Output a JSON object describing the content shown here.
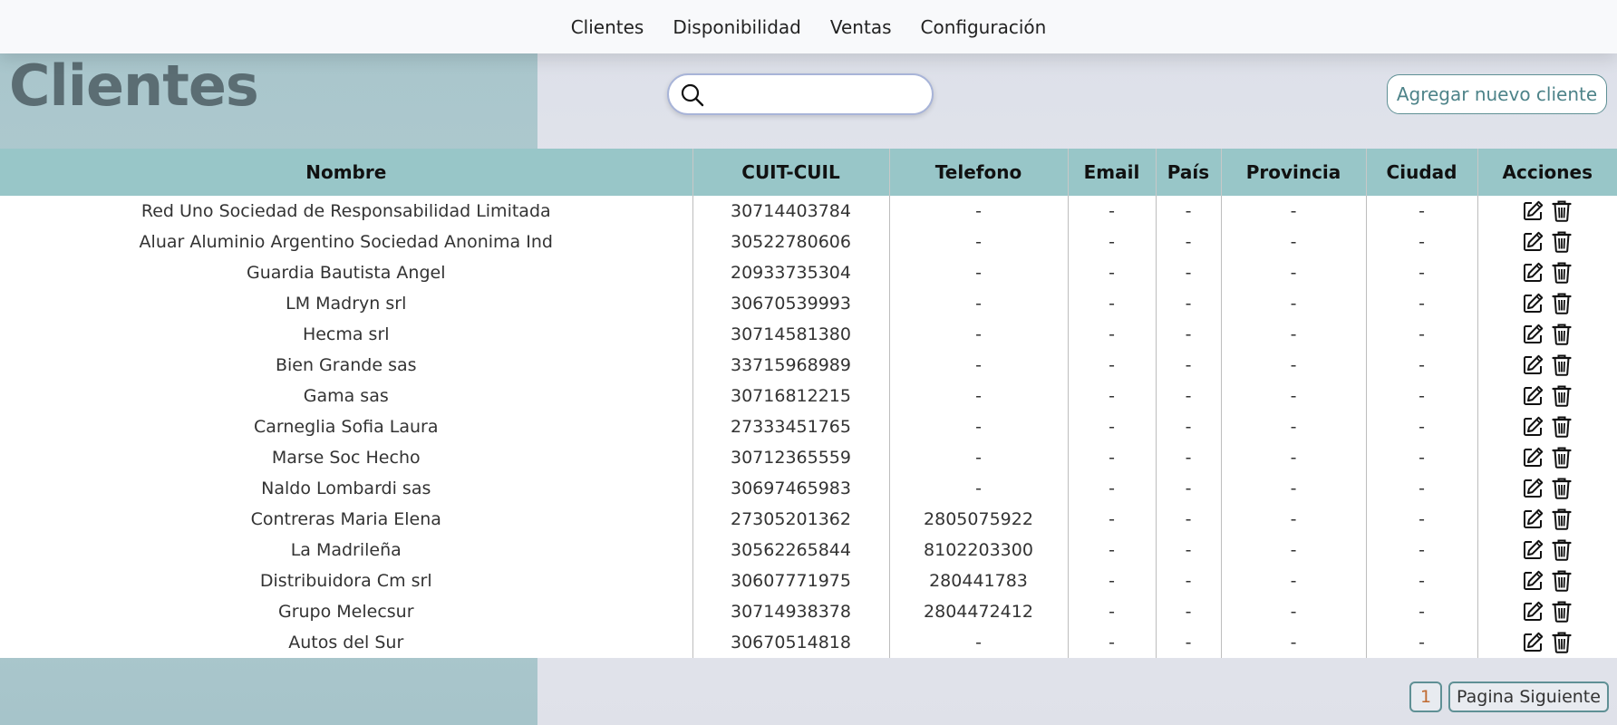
{
  "nav": {
    "items": [
      {
        "label": "Clientes"
      },
      {
        "label": "Disponibilidad"
      },
      {
        "label": "Ventas"
      },
      {
        "label": "Configuración"
      }
    ]
  },
  "header": {
    "title": "Clientes",
    "search": {
      "value": "",
      "placeholder": "",
      "icon": "search-icon"
    },
    "add_button_label": "Agregar nuevo cliente"
  },
  "table": {
    "columns": [
      "Nombre",
      "CUIT-CUIL",
      "Telefono",
      "Email",
      "País",
      "Provincia",
      "Ciudad",
      "Acciones"
    ],
    "rows": [
      {
        "nombre": "Red Uno Sociedad de Responsabilidad Limitada",
        "cuit": "30714403784",
        "telefono": "-",
        "email": "-",
        "pais": "-",
        "provincia": "-",
        "ciudad": "-"
      },
      {
        "nombre": "Aluar Aluminio Argentino Sociedad Anonima Ind",
        "cuit": "30522780606",
        "telefono": "-",
        "email": "-",
        "pais": "-",
        "provincia": "-",
        "ciudad": "-"
      },
      {
        "nombre": "Guardia Bautista Angel",
        "cuit": "20933735304",
        "telefono": "-",
        "email": "-",
        "pais": "-",
        "provincia": "-",
        "ciudad": "-"
      },
      {
        "nombre": "LM Madryn srl",
        "cuit": "30670539993",
        "telefono": "-",
        "email": "-",
        "pais": "-",
        "provincia": "-",
        "ciudad": "-"
      },
      {
        "nombre": "Hecma srl",
        "cuit": "30714581380",
        "telefono": "-",
        "email": "-",
        "pais": "-",
        "provincia": "-",
        "ciudad": "-"
      },
      {
        "nombre": "Bien Grande sas",
        "cuit": "33715968989",
        "telefono": "-",
        "email": "-",
        "pais": "-",
        "provincia": "-",
        "ciudad": "-"
      },
      {
        "nombre": "Gama sas",
        "cuit": "30716812215",
        "telefono": "-",
        "email": "-",
        "pais": "-",
        "provincia": "-",
        "ciudad": "-"
      },
      {
        "nombre": "Carneglia Sofia Laura",
        "cuit": "27333451765",
        "telefono": "-",
        "email": "-",
        "pais": "-",
        "provincia": "-",
        "ciudad": "-"
      },
      {
        "nombre": "Marse Soc Hecho",
        "cuit": "30712365559",
        "telefono": "-",
        "email": "-",
        "pais": "-",
        "provincia": "-",
        "ciudad": "-"
      },
      {
        "nombre": "Naldo Lombardi sas",
        "cuit": "30697465983",
        "telefono": "-",
        "email": "-",
        "pais": "-",
        "provincia": "-",
        "ciudad": "-"
      },
      {
        "nombre": "Contreras Maria Elena",
        "cuit": "27305201362",
        "telefono": "2805075922",
        "email": "-",
        "pais": "-",
        "provincia": "-",
        "ciudad": "-"
      },
      {
        "nombre": "La Madrileña",
        "cuit": "30562265844",
        "telefono": "8102203300",
        "email": "-",
        "pais": "-",
        "provincia": "-",
        "ciudad": "-"
      },
      {
        "nombre": "Distribuidora Cm srl",
        "cuit": "30607771975",
        "telefono": "280441783",
        "email": "-",
        "pais": "-",
        "provincia": "-",
        "ciudad": "-"
      },
      {
        "nombre": "Grupo Melecsur",
        "cuit": "30714938378",
        "telefono": "2804472412",
        "email": "-",
        "pais": "-",
        "provincia": "-",
        "ciudad": "-"
      },
      {
        "nombre": "Autos del Sur",
        "cuit": "30670514818",
        "telefono": "-",
        "email": "-",
        "pais": "-",
        "provincia": "-",
        "ciudad": "-"
      }
    ],
    "action_icons": [
      "edit-icon",
      "trash-icon"
    ]
  },
  "pagination": {
    "current_page": "1",
    "next_label": "Pagina Siguiente"
  },
  "colors": {
    "header_row": "#98c6c8",
    "left_panel": "#a9c6cc",
    "accent": "#5f9095",
    "title": "#5b6d73"
  }
}
